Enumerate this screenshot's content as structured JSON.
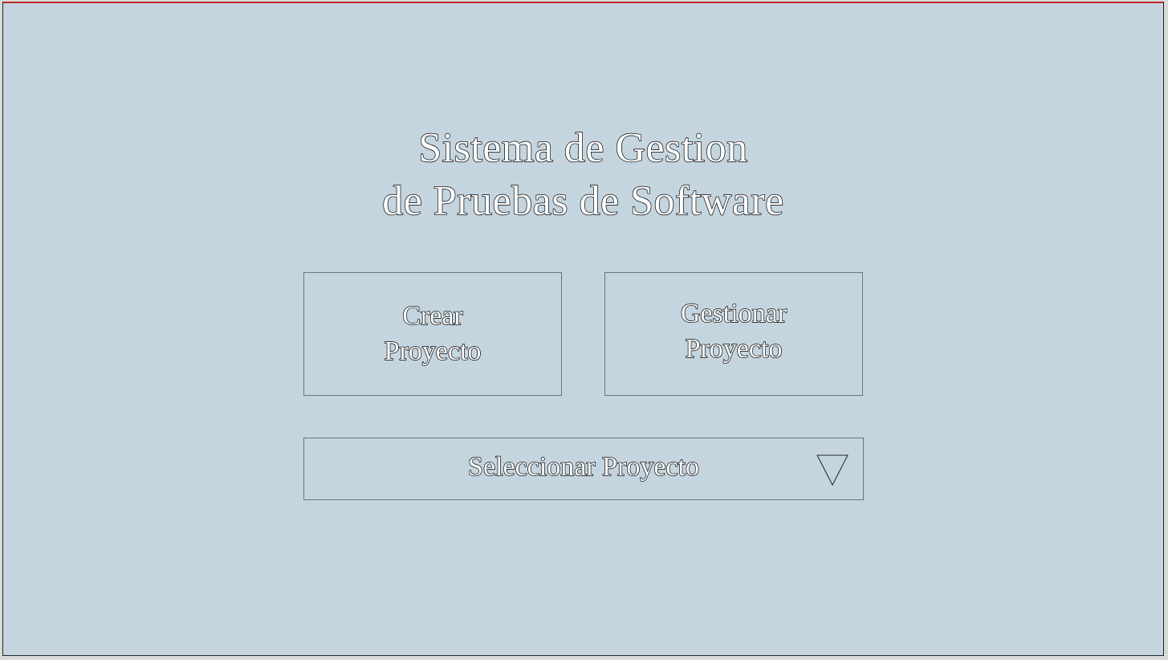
{
  "title": {
    "line1": "Sistema de Gestion",
    "line2": "de Pruebas de Software"
  },
  "buttons": {
    "create": {
      "line1": "Crear",
      "line2": "Proyecto"
    },
    "manage": {
      "line1": "Gestionar",
      "line2": "Proyecto"
    }
  },
  "project_select": {
    "label": "Seleccionar Proyecto",
    "arrow_icon": "triangle-down-icon"
  },
  "colors": {
    "background": "#c5d5e0",
    "top_border": "#c0282e"
  }
}
